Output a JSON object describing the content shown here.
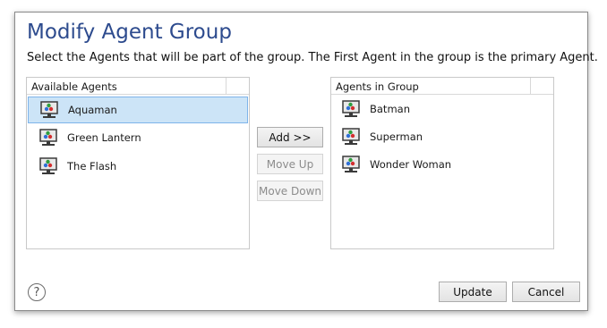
{
  "dialog": {
    "title": "Modify Agent Group",
    "subtitle": "Select the Agents that will be part of the group. The First Agent in the group is the primary Agent."
  },
  "available": {
    "header": "Available Agents",
    "items": [
      {
        "label": "Aquaman",
        "icon": "monitor-agent-icon",
        "selected": true
      },
      {
        "label": "Green Lantern",
        "icon": "monitor-agent-icon",
        "selected": false
      },
      {
        "label": "The Flash",
        "icon": "monitor-agent-icon",
        "selected": false
      }
    ]
  },
  "group": {
    "header": "Agents in Group",
    "items": [
      {
        "label": "Batman",
        "icon": "monitor-agent-icon"
      },
      {
        "label": "Superman",
        "icon": "monitor-agent-icon"
      },
      {
        "label": "Wonder Woman",
        "icon": "monitor-agent-icon"
      }
    ]
  },
  "buttons": {
    "add": "Add >>",
    "move_up": "Move Up",
    "move_down": "Move Down",
    "update": "Update",
    "cancel": "Cancel"
  },
  "help_icon_glyph": "?",
  "colors": {
    "title": "#2d4b8e",
    "selection": "#cce4f7",
    "selection_border": "#7eb4ea"
  }
}
